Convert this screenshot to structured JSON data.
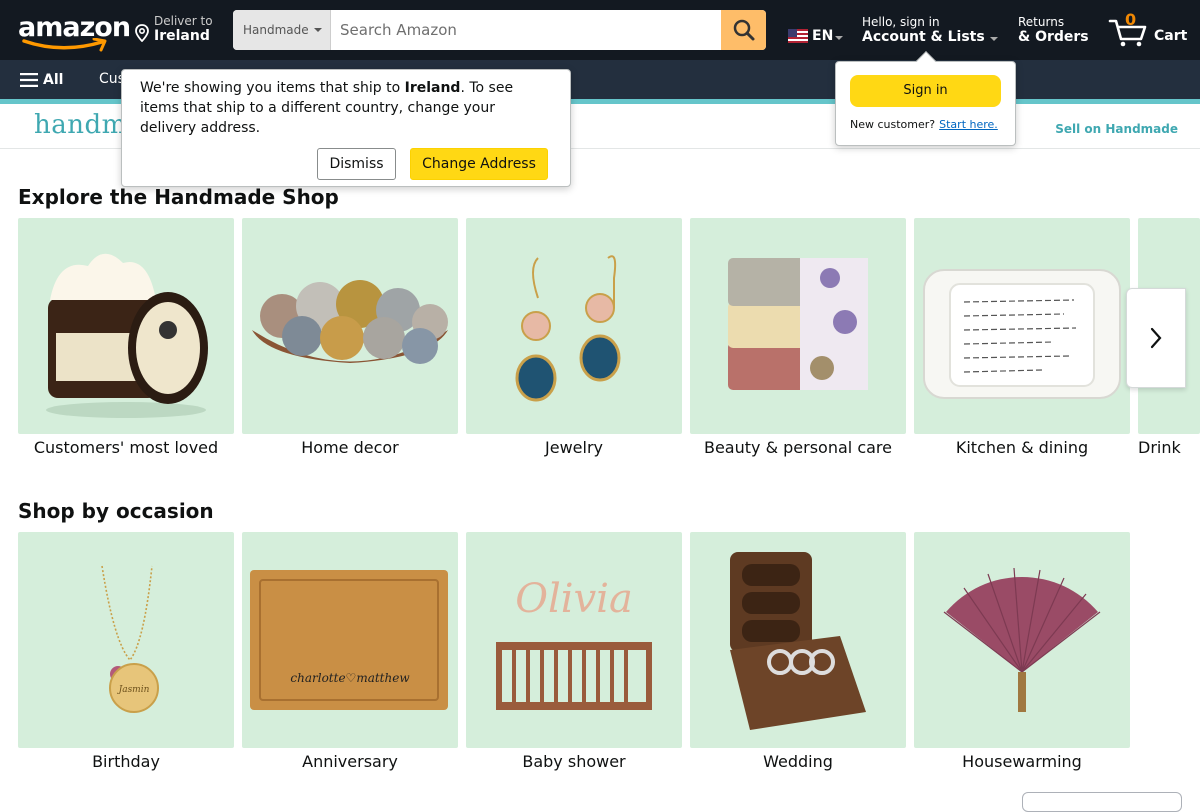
{
  "header": {
    "logo_text": "amazon",
    "deliver_label": "Deliver to",
    "deliver_location": "Ireland",
    "search_category": "Handmade",
    "search_placeholder": "Search Amazon",
    "language": "EN",
    "account_greeting": "Hello, sign in",
    "account_label": "Account & Lists",
    "returns_label": "Returns",
    "orders_label": "& Orders",
    "cart_count": "0",
    "cart_label": "Cart"
  },
  "subnav": {
    "all_label": "All",
    "link_partial": "Cus"
  },
  "handmade_bar": {
    "logo_text": "handma",
    "sell_link": "Sell on Handmade"
  },
  "address_popover": {
    "message_before": "We're showing you items that ship to ",
    "country": "Ireland",
    "message_after": ". To see items that ship to a different country, change your delivery address.",
    "dismiss_label": "Dismiss",
    "change_label": "Change Address"
  },
  "signin_popover": {
    "signin_label": "Sign in",
    "new_customer": "New customer?",
    "start_here": "Start here."
  },
  "explore": {
    "title": "Explore the Handmade Shop",
    "cards": [
      {
        "label": "Customers' most loved",
        "icon": "cream-jar-icon"
      },
      {
        "label": "Home decor",
        "icon": "yarn-bowl-icon"
      },
      {
        "label": "Jewelry",
        "icon": "earrings-icon"
      },
      {
        "label": "Beauty & personal care",
        "icon": "soap-bars-icon"
      },
      {
        "label": "Kitchen & dining",
        "icon": "baking-dish-icon"
      },
      {
        "label": "Drink",
        "icon": "drink-icon"
      }
    ]
  },
  "occasion": {
    "title": "Shop by occasion",
    "cards": [
      {
        "label": "Birthday",
        "icon": "necklace-icon"
      },
      {
        "label": "Anniversary",
        "icon": "cutting-board-icon"
      },
      {
        "label": "Baby shower",
        "icon": "crib-icon"
      },
      {
        "label": "Wedding",
        "icon": "ring-box-icon"
      },
      {
        "label": "Housewarming",
        "icon": "hand-fan-icon"
      }
    ]
  },
  "decor_text": {
    "cutting_board": "charlotte♡matthew",
    "crib_name": "Olivia",
    "necklace_name": "Jasmin"
  },
  "colors": {
    "nav_dark": "#131921",
    "nav_sub": "#232f3e",
    "accent_teal": "#3fa8b1",
    "card_bg": "#d5eedb",
    "button_yellow": "#ffd814",
    "search_orange": "#febd69"
  }
}
